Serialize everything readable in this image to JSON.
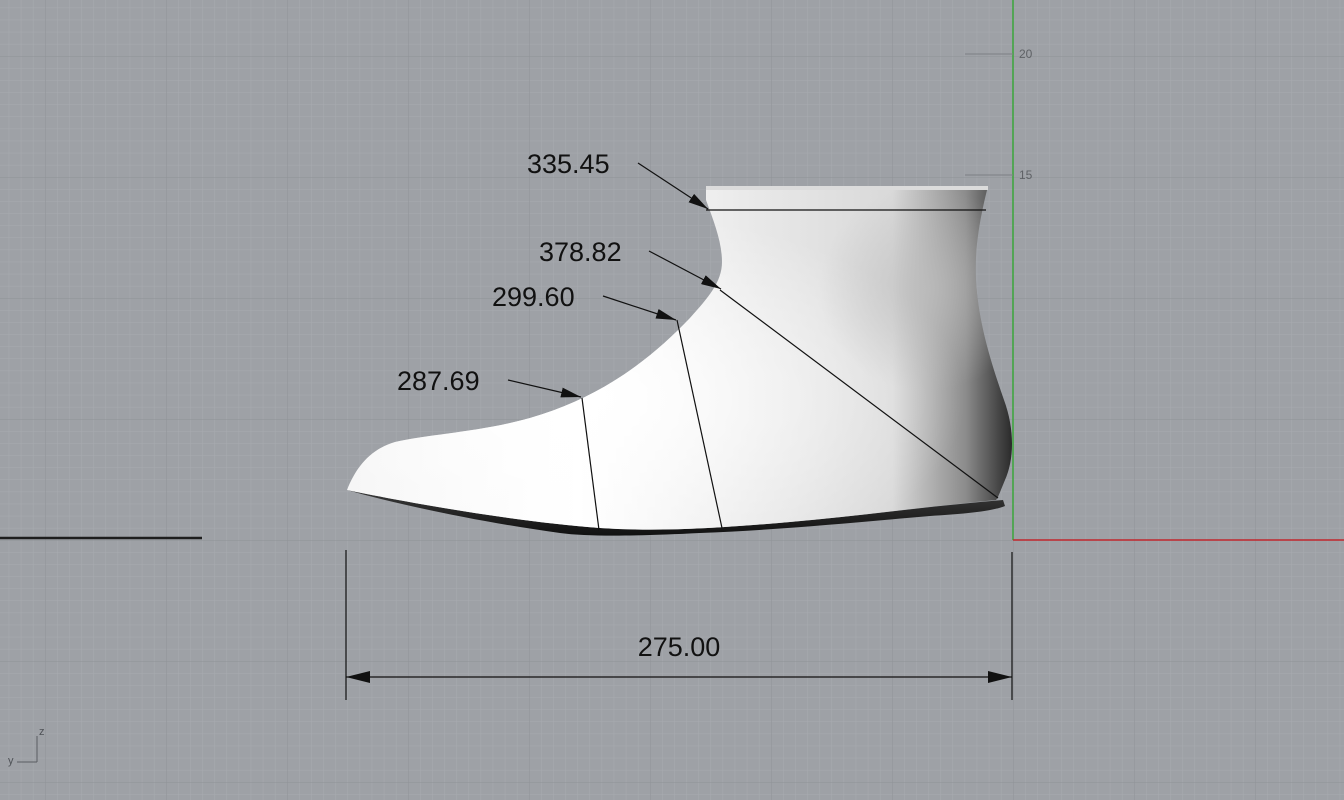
{
  "viewport": {
    "background": "#9ea1a6",
    "grid_minor_color": "#a8abb0",
    "grid_major_color": "#8f9297",
    "x_axis_color": "#c0272d",
    "y_axis_color": "#3aa63a"
  },
  "ruler": {
    "ticks": [
      "20",
      "15"
    ]
  },
  "dimensions": {
    "length": "275.00",
    "girth_top": "335.45",
    "girth_heel": "378.82",
    "girth_instep": "299.60",
    "girth_ball": "287.69"
  },
  "axis_widget": {
    "z_label": "z",
    "y_label": "y"
  },
  "model": {
    "shading_light": "#ffffff",
    "shading_dark": "#2a2a2a"
  }
}
